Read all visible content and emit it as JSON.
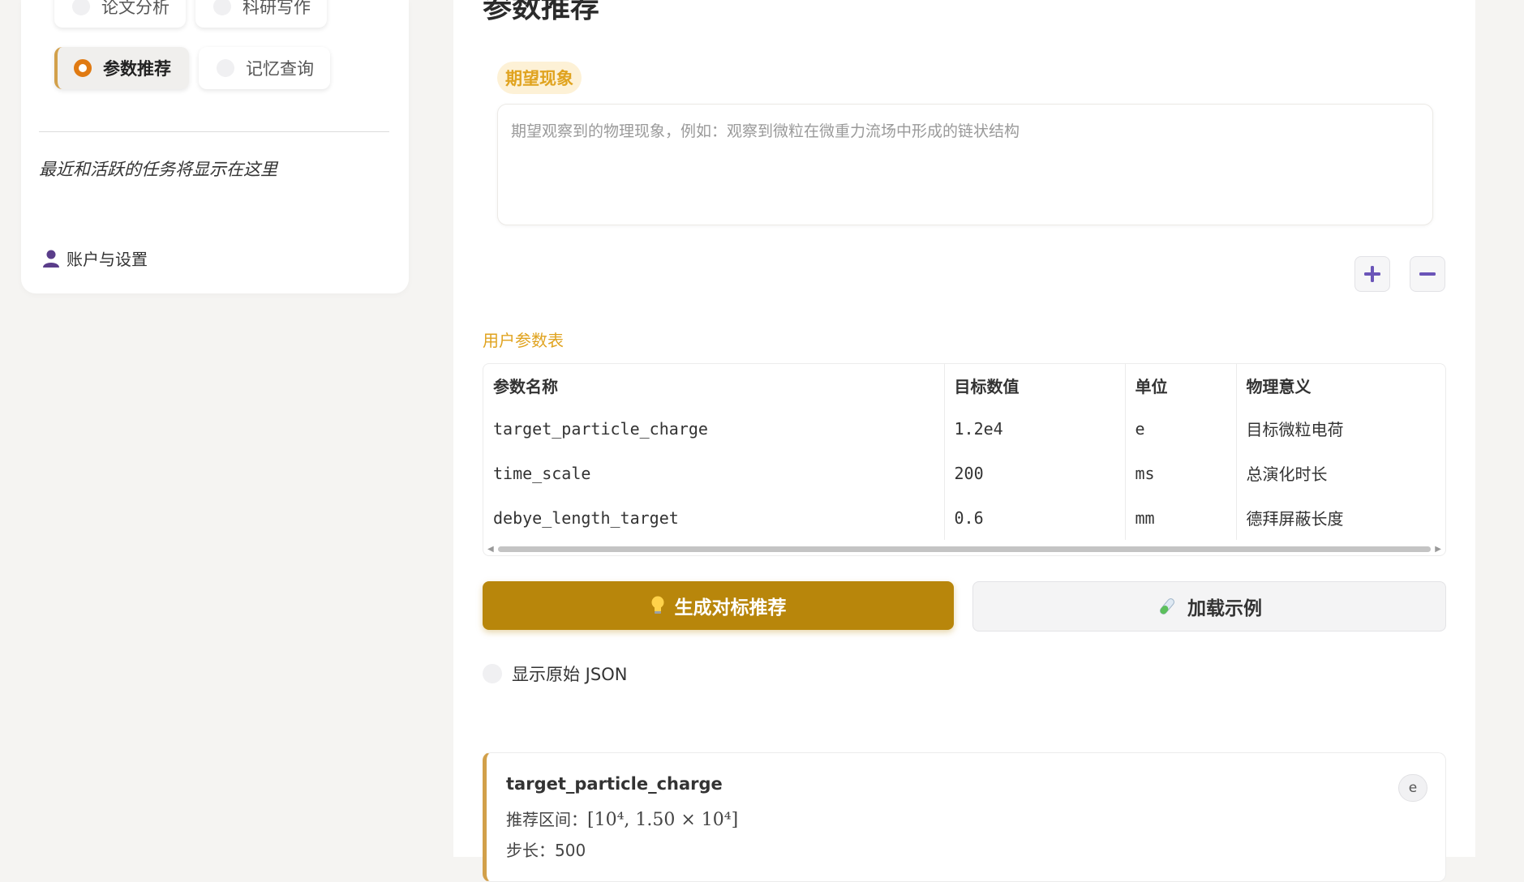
{
  "sidebar": {
    "nav": [
      {
        "label": "论文分析",
        "active": false
      },
      {
        "label": "科研写作",
        "active": false
      },
      {
        "label": "参数推荐",
        "active": true
      },
      {
        "label": "记忆查询",
        "active": false
      }
    ],
    "recent_placeholder": "最近和活跃的任务将显示在这里",
    "account_label": "账户与设置",
    "account_icon": "user-icon"
  },
  "main": {
    "title": "参数推荐",
    "phenomenon_tag": "期望现象",
    "phenomenon_placeholder": "期望观察到的物理现象，例如：观察到微粒在微重力流场中形成的链状结构",
    "add_icon": "plus-icon",
    "remove_icon": "minus-icon",
    "table_label": "用户参数表",
    "table": {
      "headers": [
        "参数名称",
        "目标数值",
        "单位",
        "物理意义"
      ],
      "rows": [
        [
          "target_particle_charge",
          "1.2e4",
          "e",
          "目标微粒电荷"
        ],
        [
          "time_scale",
          "200",
          "ms",
          "总演化时长"
        ],
        [
          "debye_length_target",
          "0.6",
          "mm",
          "德拜屏蔽长度"
        ]
      ]
    },
    "generate_button": "生成对标推荐",
    "generate_icon": "lightbulb-icon",
    "load_example_button": "加载示例",
    "load_example_icon": "test-tube-icon",
    "show_json_label": "显示原始 JSON",
    "show_json_on": false,
    "result": {
      "name": "target_particle_charge",
      "range_label": "推荐区间：",
      "range_math": "[10⁴, 1.50 × 10⁴]",
      "step_label": "步长：",
      "step_value": "500",
      "unit_badge": "e"
    }
  },
  "colors": {
    "accent": "#b8860b",
    "accent_light": "#e0a31f",
    "radio_active": "#e07a12",
    "tag_bg": "#fdf1d6",
    "icon_purple": "#6b55b8"
  }
}
